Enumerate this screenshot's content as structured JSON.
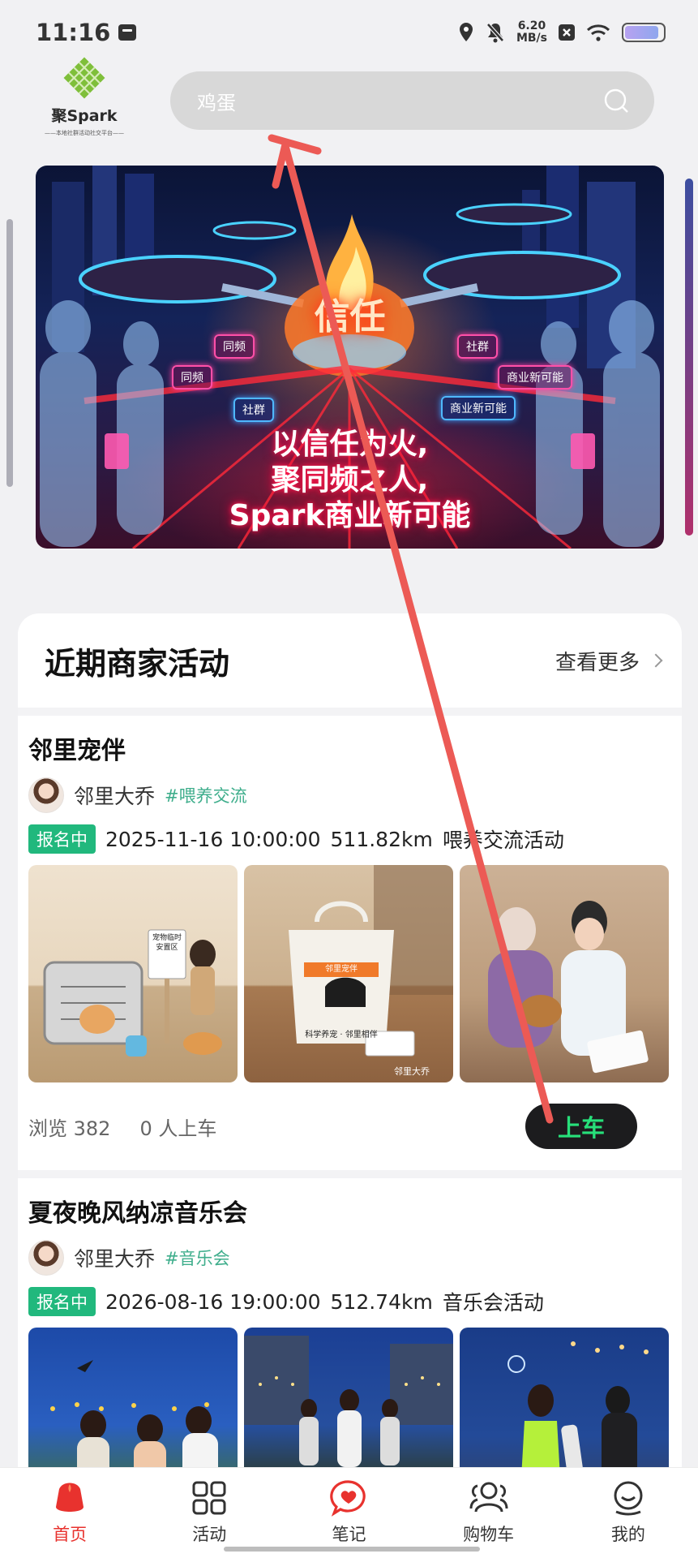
{
  "status_bar": {
    "time": "11:16",
    "net_speed_value": "6.20",
    "net_speed_unit": "MB/s",
    "battery_level": 0.9,
    "icons": [
      "message-icon",
      "location-icon",
      "mute-icon",
      "close-box-icon",
      "wifi-icon",
      "battery-icon"
    ]
  },
  "header": {
    "logo_name": "聚Spark",
    "logo_slogan": "——本地社群活动社交平台——",
    "search_placeholder": "鸡蛋"
  },
  "banner": {
    "center_text": "信任",
    "lines": [
      "以信任为火,",
      "聚同频之人,",
      "Spark商业新可能"
    ],
    "tags": [
      "同频",
      "同频",
      "社群",
      "社群",
      "商业新可能",
      "商业新可能"
    ]
  },
  "section": {
    "title": "近期商家活动",
    "see_more": "查看更多"
  },
  "events": [
    {
      "title": "邻里宠伴",
      "author": "邻里大乔",
      "tag": "#喂养交流",
      "status": "报名中",
      "datetime": "2025-11-16 10:00:00",
      "distance": "511.82km",
      "category": "喂养交流活动",
      "photo_sign": "宠物临时安置区",
      "photo_bag_label": "邻里宠伴",
      "photo_bag_caption": "科学养宠 · 邻里相伴",
      "photo_watermark": "邻里大乔",
      "views": "浏览 382",
      "riders": "0 人上车",
      "action": "上车"
    },
    {
      "title": "夏夜晚风纳凉音乐会",
      "author": "邻里大乔",
      "tag": "#音乐会",
      "status": "报名中",
      "datetime": "2026-08-16 19:00:00",
      "distance": "512.74km",
      "category": "音乐会活动"
    }
  ],
  "tabs": [
    {
      "label": "首页",
      "icon": "home-icon",
      "active": true
    },
    {
      "label": "活动",
      "icon": "grid-icon",
      "active": false
    },
    {
      "label": "笔记",
      "icon": "heart-bubble-icon",
      "active": false
    },
    {
      "label": "购物车",
      "icon": "people-icon",
      "active": false
    },
    {
      "label": "我的",
      "icon": "profile-icon",
      "active": false
    }
  ],
  "colors": {
    "accent_red": "#e8322e",
    "badge_green": "#21b87d",
    "tag_green": "#3fae8c",
    "button_bg": "#1c1c1e",
    "button_text": "#27e07a",
    "annotation_arrow": "#ec5a55"
  }
}
